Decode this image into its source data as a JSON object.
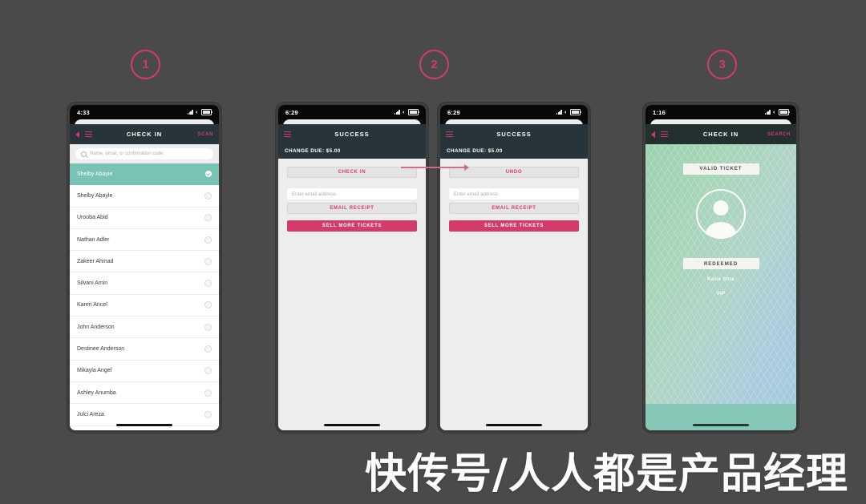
{
  "page": {
    "background_color": "#4a4a4a",
    "watermark": "快传号/人人都是产品经理",
    "accent_pink": "#d33b6a",
    "teal": "#79c3b4",
    "dark_nav": "#27353a"
  },
  "steps": [
    {
      "label": "1"
    },
    {
      "label": "2"
    },
    {
      "label": "3"
    }
  ],
  "flow_arrow": {
    "name": "flow-arrow",
    "direction": "right"
  },
  "phone1": {
    "status": {
      "time": "4:33",
      "signal": "signal-icon",
      "wifi": "wifi-icon",
      "battery": "battery-icon"
    },
    "nav": {
      "back": "back-chevron-icon",
      "menu": "hamburger-icon",
      "title": "CHECK IN",
      "action": "SCAN"
    },
    "search": {
      "placeholder": "Name, email, or confirmation code",
      "icon": "search-icon"
    },
    "attendees": [
      {
        "name": "Shelby Abayie",
        "selected": true
      },
      {
        "name": "Shelby Abayle",
        "selected": false
      },
      {
        "name": "Urooba Abid",
        "selected": false
      },
      {
        "name": "Nathan Adler",
        "selected": false
      },
      {
        "name": "Zakeer Ahmad",
        "selected": false
      },
      {
        "name": "Silvani Amin",
        "selected": false
      },
      {
        "name": "Karen Ancel",
        "selected": false
      },
      {
        "name": "John Anderson",
        "selected": false
      },
      {
        "name": "Destinee Anderson",
        "selected": false
      },
      {
        "name": "Mikayla Angel",
        "selected": false
      },
      {
        "name": "Ashley Anumba",
        "selected": false
      },
      {
        "name": "Julci Areza",
        "selected": false
      }
    ]
  },
  "phone2": {
    "status": {
      "time": "6:29",
      "signal": "signal-icon",
      "wifi": "wifi-icon",
      "battery": "battery-icon"
    },
    "nav": {
      "menu": "hamburger-icon",
      "title": "SUCCESS"
    },
    "subbar": "CHANGE DUE: $5.00",
    "primary_action": "CHECK IN",
    "email_placeholder": "Enter email address",
    "email_receipt": "EMAIL RECEIPT",
    "sell_more": "SELL MORE TICKETS"
  },
  "phone3": {
    "status": {
      "time": "6:29",
      "signal": "signal-icon",
      "wifi": "wifi-icon",
      "battery": "battery-icon"
    },
    "nav": {
      "menu": "hamburger-icon",
      "title": "SUCCESS"
    },
    "subbar": "CHANGE DUE: $5.00",
    "primary_action": "UNDO",
    "email_placeholder": "Enter email address",
    "email_receipt": "EMAIL RECEIPT",
    "sell_more": "SELL MORE TICKETS"
  },
  "phone4": {
    "status": {
      "time": "1:16",
      "signal": "signal-icon",
      "wifi": "wifi-icon",
      "battery": "battery-icon"
    },
    "nav": {
      "back": "back-chevron-icon",
      "menu": "hamburger-icon",
      "title": "CHECK IN",
      "action": "SEARCH"
    },
    "valid_badge": "VALID TICKET",
    "avatar": "person-avatar-icon",
    "redeemed_badge": "REDEEMED",
    "guest_name": "Katie Shia",
    "guest_tier": "VIP"
  }
}
